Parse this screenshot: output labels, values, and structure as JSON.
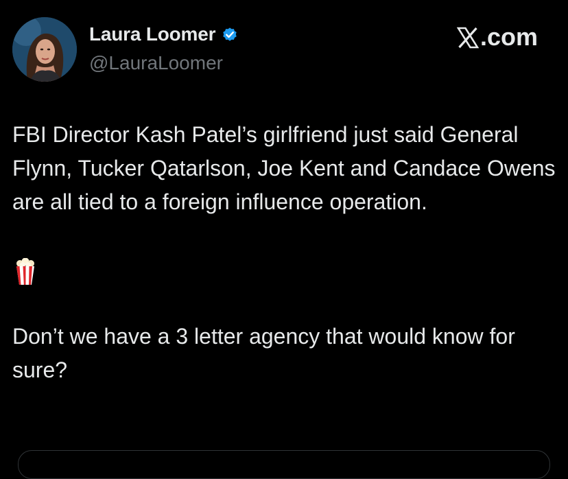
{
  "author": {
    "display_name": "Laura Loomer",
    "handle": "@LauraLoomer",
    "verified_icon": "verified-badge-icon",
    "avatar_icon": "avatar-photo"
  },
  "brand": {
    "label": ".com",
    "icon": "x-logo-icon"
  },
  "tweet": {
    "paragraph_1": "FBI Director Kash Patel’s girlfriend just said General Flynn, Tucker Qatarlson, Joe Kent and Candace Owens are all tied to a foreign influence operation.",
    "emoji": "popcorn-icon",
    "paragraph_2": "Don’t we have a 3 letter agency that would know for sure?"
  },
  "colors": {
    "background": "#000000",
    "text": "#e7e9ea",
    "secondary_text": "#71767b",
    "verified_blue": "#1d9bf0"
  }
}
